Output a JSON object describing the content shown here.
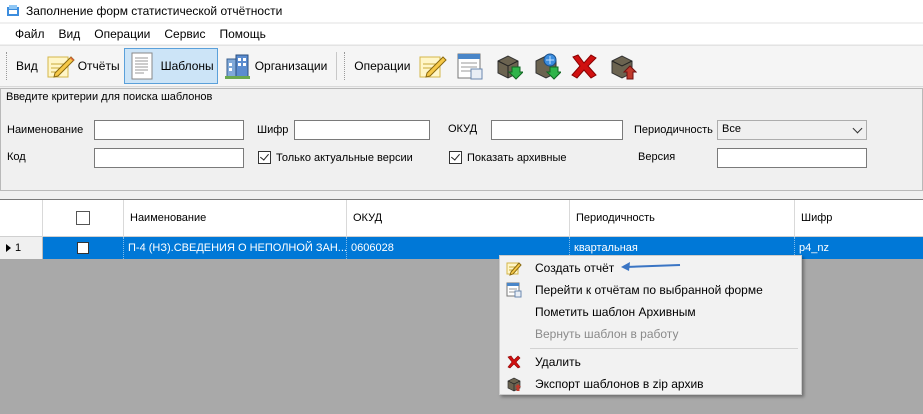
{
  "window": {
    "title": "Заполнение форм статистической отчётности"
  },
  "menu": [
    "Файл",
    "Вид",
    "Операции",
    "Сервис",
    "Помощь"
  ],
  "toolbar": {
    "view_label": "Вид",
    "reports_label": "Отчёты",
    "templates_label": "Шаблоны",
    "orgs_label": "Организации",
    "operations_label": "Операции",
    "icons": [
      "pencil-note-icon",
      "form-list-icon",
      "import-down-icon",
      "globe-download-icon",
      "delete-x-icon",
      "export-up-icon"
    ]
  },
  "criteria": {
    "caption": "Введите критерии для поиска шаблонов",
    "name_label": "Наименование",
    "code_label": "Код",
    "cipher_label": "Шифр",
    "okud_label": "ОКУД",
    "period_label": "Периодичность",
    "version_label": "Версия",
    "period_value": "Все",
    "only_actual_label": "Только актуальные версии",
    "show_archive_label": "Показать архивные",
    "only_actual_checked": true,
    "show_archive_checked": true
  },
  "grid": {
    "columns": [
      "Наименование",
      "ОКУД",
      "Периодичность",
      "Шифр"
    ],
    "rows": [
      {
        "num": "1",
        "name": "П-4 (НЗ).СВЕДЕНИЯ О НЕПОЛНОЙ ЗАН...",
        "okud": "0606028",
        "period": "квартальная",
        "cipher": "p4_nz"
      }
    ]
  },
  "context_menu": {
    "items": [
      {
        "label": "Создать отчёт",
        "icon": "pencil-note-icon",
        "enabled": true
      },
      {
        "label": "Перейти к отчётам по выбранной форме",
        "icon": "form-list-icon",
        "enabled": true
      },
      {
        "label": "Пометить шаблон Архивным",
        "icon": "",
        "enabled": true
      },
      {
        "label": "Вернуть шаблон в работу",
        "icon": "",
        "enabled": false
      },
      {
        "label": "Удалить",
        "icon": "delete-x-icon",
        "enabled": true
      },
      {
        "label": "Экспорт шаблонов в zip архив",
        "icon": "archive-export-icon",
        "enabled": true
      }
    ]
  },
  "colors": {
    "selection": "#0078d7",
    "annotation_arrow": "#3a75c4",
    "delete_red": "#d01010"
  }
}
